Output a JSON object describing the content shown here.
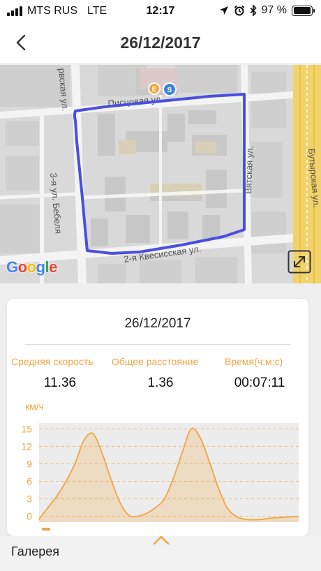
{
  "status_bar": {
    "carrier": "MTS RUS",
    "network": "LTE",
    "time": "12:17",
    "battery": "97 %",
    "battery_level": 0.97
  },
  "header": {
    "title": "26/12/2017"
  },
  "map": {
    "streets": [
      "Писцовая ул.",
      "Вятская ул.",
      "2-я Квесисская ул.",
      "3-я ул. Бебеля",
      "Бутырская ул.",
      "рвская ул."
    ],
    "markers": [
      "E",
      "S"
    ],
    "attribution": "Google",
    "route_color": "#4a4fe0"
  },
  "summary": {
    "date": "26/12/2017",
    "stats": [
      {
        "label": "Средняя скорость",
        "value": "11.36"
      },
      {
        "label": "Общее расстояние",
        "value": "1.36"
      },
      {
        "label": "Время(ч:м:с)",
        "value": "00:07:11"
      }
    ],
    "unit": "км/ч"
  },
  "chart_data": {
    "type": "area",
    "ylabel": "км/ч",
    "ylim": [
      -1,
      16
    ],
    "yticks": [
      0,
      3,
      6,
      9,
      12,
      15
    ],
    "grid": true,
    "color": "#f0a643",
    "x": [
      0,
      1,
      2,
      3,
      4,
      5,
      6,
      7,
      8,
      9,
      10,
      11,
      12,
      13,
      14,
      15,
      16,
      17,
      18,
      19,
      20,
      21,
      22,
      23,
      24,
      25,
      26,
      27,
      28,
      29
    ],
    "values": [
      -0.5,
      1.5,
      3.5,
      6,
      9,
      13,
      14.2,
      11,
      6.5,
      2.5,
      0.2,
      0,
      0.5,
      1.5,
      3,
      6.5,
      11,
      15,
      13.5,
      9.5,
      5,
      1.5,
      0,
      -0.5,
      -0.6,
      -0.5,
      -0.3,
      -0.2,
      -0.1,
      0
    ]
  },
  "footer": {
    "gallery_label": "Галерея"
  }
}
